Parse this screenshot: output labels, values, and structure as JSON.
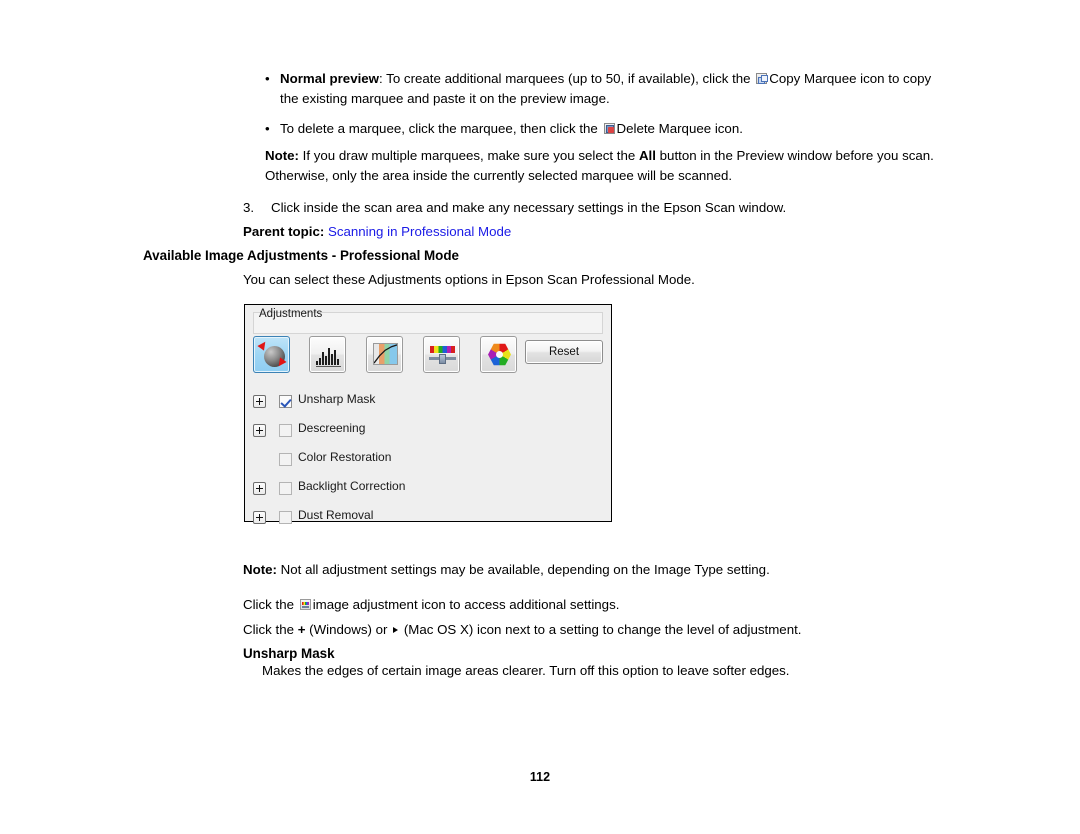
{
  "document": {
    "page_number": "112",
    "bullets": [
      {
        "bullet": "•",
        "lead": "Normal preview",
        "text_before_icon": ": To create additional marquees (up to 50, if available), click the ",
        "icon": "copy-marquee-icon",
        "text_after_icon": "Copy Marquee icon to copy the existing marquee and paste it on the preview image."
      },
      {
        "bullet": "•",
        "lead": "",
        "text_before_icon": "To delete a marquee, click the marquee, then click the ",
        "icon": "delete-marquee-icon",
        "text_after_icon": "Delete Marquee icon."
      }
    ],
    "note1": {
      "label": "Note:",
      "text_part1": " If you draw multiple marquees, make sure you select the ",
      "bold_word": "All",
      "text_part2": " button in the Preview window before you scan. Otherwise, only the area inside the currently selected marquee will be scanned."
    },
    "step3": {
      "number": "3.",
      "text": "Click inside the scan area and make any necessary settings in the Epson Scan window."
    },
    "parent_topic": {
      "label": "Parent topic:",
      "link": "Scanning in Professional Mode"
    },
    "section_heading": "Available Image Adjustments - Professional Mode",
    "intro_line": "You can select these Adjustments options in Epson Scan Professional Mode.",
    "note2": {
      "label": "Note:",
      "text": " Not all adjustment settings may be available, depending on the Image Type setting."
    },
    "line_a": {
      "before_icon": "Click the ",
      "icon": "image-adjustment-icon",
      "after_icon": "image adjustment icon to access additional settings."
    },
    "line_b": {
      "before_plus": "Click the ",
      "plus": "+",
      "middle": " (Windows) or ",
      "arrow": "▸",
      "after_arrow": " (Mac OS X) icon next to a setting to change the level of adjustment."
    },
    "sub_heading": "Unsharp Mask",
    "sub_body": "Makes the edges of certain image areas clearer. Turn off this option to leave softer edges."
  },
  "dialog": {
    "groupbox_label": "Adjustments",
    "reset_button": "Reset",
    "toolbar_icons": [
      {
        "name": "unsharp-mask-icon",
        "selected": true
      },
      {
        "name": "histogram-adjustment-icon",
        "selected": false
      },
      {
        "name": "tone-correction-icon",
        "selected": false
      },
      {
        "name": "image-adjustment-icon",
        "selected": false
      },
      {
        "name": "color-palette-icon",
        "selected": false
      }
    ],
    "options": [
      {
        "label": "Unsharp Mask",
        "underline": "k",
        "checked": true,
        "expandable": true
      },
      {
        "label": "Descreening",
        "underline": "e",
        "checked": false,
        "expandable": true
      },
      {
        "label": "Color Restoration",
        "underline": "r",
        "checked": false,
        "expandable": false
      },
      {
        "label": "Backlight Correction",
        "underline": "B",
        "checked": false,
        "expandable": true
      },
      {
        "label": "Dust Removal",
        "underline": "D",
        "checked": false,
        "expandable": true
      }
    ]
  },
  "colors": {
    "link": "#1a1ae6",
    "dialog_bg": "#efefef",
    "selected_button": "#9fd6f4"
  }
}
